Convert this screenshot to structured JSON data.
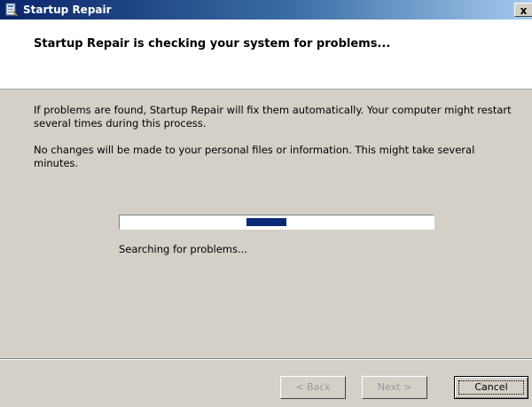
{
  "window": {
    "title": "Startup Repair",
    "close_glyph": "x",
    "icons": {
      "app": "startup-repair-app-icon"
    }
  },
  "header": {
    "heading": "Startup Repair is checking your system for problems..."
  },
  "body": {
    "paragraph1": "If problems are found, Startup Repair will fix them automatically. Your computer might restart several times during this process.",
    "paragraph2": "No changes will be made to your personal files or information. This might take several minutes."
  },
  "progress": {
    "status_text": "Searching for problems...",
    "marquee_start": 0.405,
    "marquee_end": 0.53,
    "fill_color": "#0a2a78"
  },
  "buttons": {
    "back": "< Back",
    "next": "Next >",
    "cancel": "Cancel"
  }
}
